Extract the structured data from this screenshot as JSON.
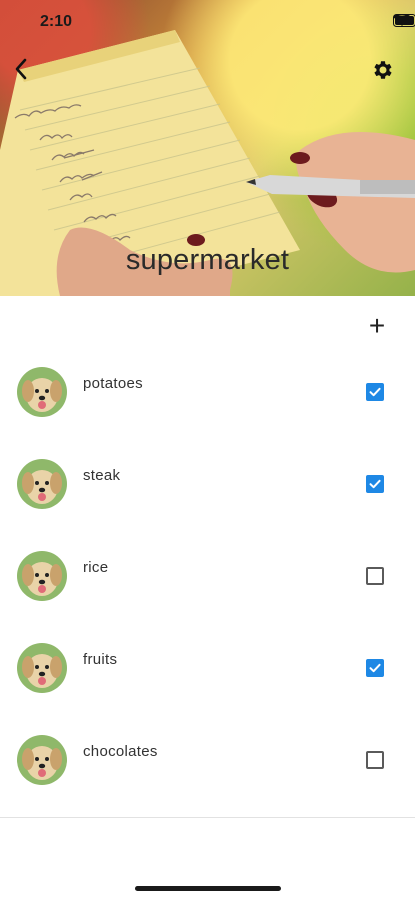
{
  "status_bar": {
    "time": "2:10"
  },
  "header": {
    "title": "supermarket"
  },
  "items": [
    {
      "label": "potatoes",
      "checked": true
    },
    {
      "label": "steak",
      "checked": true
    },
    {
      "label": "rice",
      "checked": false
    },
    {
      "label": "fruits",
      "checked": true
    },
    {
      "label": "chocolates",
      "checked": false
    }
  ],
  "colors": {
    "accent": "#1e88e5",
    "checkbox_border": "#5a5a5a"
  },
  "icons": {
    "back": "chevron-left-icon",
    "settings": "gear-icon",
    "add": "plus-icon"
  },
  "add_symbol": "+"
}
